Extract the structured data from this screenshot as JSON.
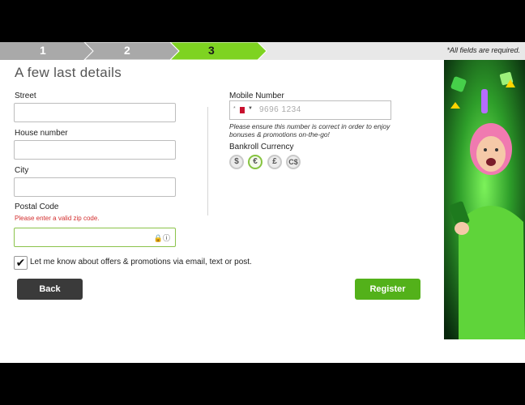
{
  "steps": [
    {
      "label": "1",
      "state": "done"
    },
    {
      "label": "2",
      "state": "done"
    },
    {
      "label": "3",
      "state": "active"
    }
  ],
  "required_note": "*All fields are required.",
  "title": "A few last details",
  "street": {
    "label": "Street",
    "value": ""
  },
  "house_number": {
    "label": "House number",
    "value": ""
  },
  "city": {
    "label": "City",
    "value": ""
  },
  "postal_code": {
    "label": "Postal Code",
    "error": "Please enter a valid zip code.",
    "value": ""
  },
  "mobile": {
    "label": "Mobile Number",
    "prefix": "*",
    "placeholder": "9696 1234",
    "hint": "Please ensure this number is correct in order to enjoy bonuses & promotions on-the-go!"
  },
  "currency": {
    "label": "Bankroll Currency",
    "options": [
      "$",
      "€",
      "£",
      "C$"
    ],
    "selected": "€"
  },
  "consent": {
    "label": "Let me know about offers & promotions via email, text or post.",
    "checked": true
  },
  "buttons": {
    "back": "Back",
    "register": "Register"
  },
  "colors": {
    "accent": "#53b11a",
    "step_active": "#7ed321",
    "step_done": "#a8a8a8",
    "error": "#d32f2f"
  }
}
